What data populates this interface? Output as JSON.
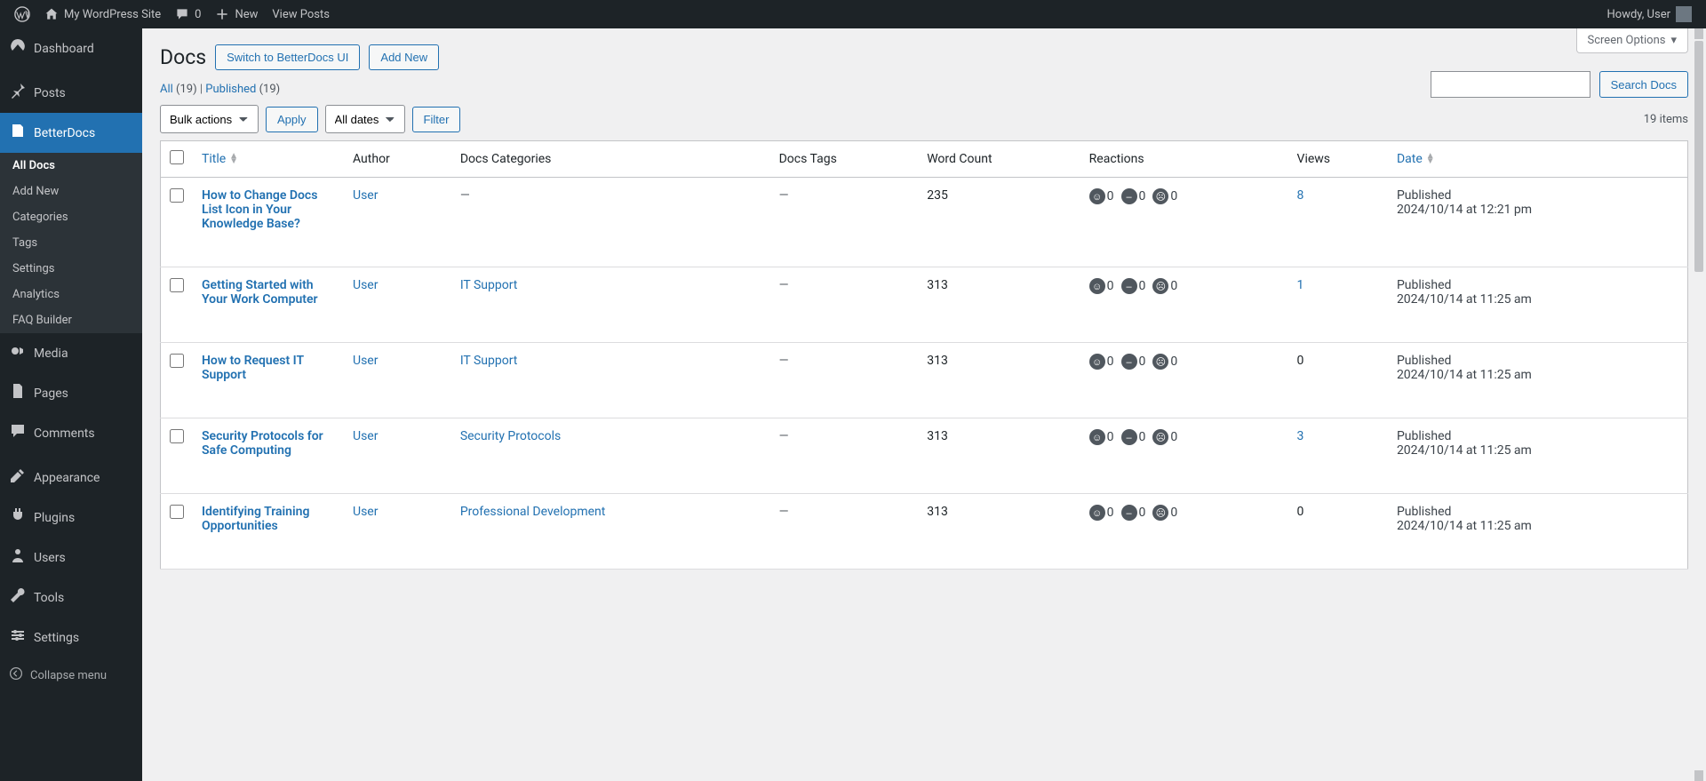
{
  "adminbar": {
    "site_name": "My WordPress Site",
    "comments_count": "0",
    "new_label": "New",
    "view_posts": "View Posts",
    "howdy": "Howdy, User"
  },
  "sidebar": {
    "dashboard": "Dashboard",
    "posts": "Posts",
    "betterdocs": "BetterDocs",
    "submenu": {
      "all_docs": "All Docs",
      "add_new": "Add New",
      "categories": "Categories",
      "tags": "Tags",
      "settings": "Settings",
      "analytics": "Analytics",
      "faq_builder": "FAQ Builder"
    },
    "media": "Media",
    "pages": "Pages",
    "comments": "Comments",
    "appearance": "Appearance",
    "plugins": "Plugins",
    "users": "Users",
    "tools": "Tools",
    "settings": "Settings",
    "collapse": "Collapse menu"
  },
  "header": {
    "screen_options": "Screen Options",
    "title": "Docs",
    "switch_ui": "Switch to BetterDocs UI",
    "add_new": "Add New"
  },
  "filters": {
    "all_label": "All",
    "all_count": "(19)",
    "published_label": "Published",
    "published_count": "(19)",
    "sep": " | "
  },
  "search": {
    "button": "Search Docs"
  },
  "bulk": {
    "bulk_actions": "Bulk actions",
    "apply": "Apply",
    "all_dates": "All dates",
    "filter": "Filter"
  },
  "pagination": {
    "items": "19 items"
  },
  "columns": {
    "title": "Title",
    "author": "Author",
    "docs_categories": "Docs Categories",
    "docs_tags": "Docs Tags",
    "word_count": "Word Count",
    "reactions": "Reactions",
    "views": "Views",
    "date": "Date"
  },
  "rows": [
    {
      "title": "How to Change Docs List Icon in Your Knowledge Base?",
      "author": "User",
      "category": "—",
      "tags": "—",
      "word_count": "235",
      "reactions": {
        "happy": "0",
        "neutral": "0",
        "sad": "0"
      },
      "views": "8",
      "views_link": true,
      "status": "Published",
      "date": "2024/10/14 at 12:21 pm"
    },
    {
      "title": "Getting Started with Your Work Computer",
      "author": "User",
      "category": "IT Support",
      "category_link": true,
      "tags": "—",
      "word_count": "313",
      "reactions": {
        "happy": "0",
        "neutral": "0",
        "sad": "0"
      },
      "views": "1",
      "views_link": true,
      "status": "Published",
      "date": "2024/10/14 at 11:25 am"
    },
    {
      "title": "How to Request IT Support",
      "author": "User",
      "category": "IT Support",
      "category_link": true,
      "tags": "—",
      "word_count": "313",
      "reactions": {
        "happy": "0",
        "neutral": "0",
        "sad": "0"
      },
      "views": "0",
      "views_link": false,
      "status": "Published",
      "date": "2024/10/14 at 11:25 am"
    },
    {
      "title": "Security Protocols for Safe Computing",
      "author": "User",
      "category": "Security Protocols",
      "category_link": true,
      "tags": "—",
      "word_count": "313",
      "reactions": {
        "happy": "0",
        "neutral": "0",
        "sad": "0"
      },
      "views": "3",
      "views_link": true,
      "status": "Published",
      "date": "2024/10/14 at 11:25 am"
    },
    {
      "title": "Identifying Training Opportunities",
      "author": "User",
      "category": "Professional Development",
      "category_link": true,
      "tags": "—",
      "word_count": "313",
      "reactions": {
        "happy": "0",
        "neutral": "0",
        "sad": "0"
      },
      "views": "0",
      "views_link": false,
      "status": "Published",
      "date": "2024/10/14 at 11:25 am"
    }
  ]
}
